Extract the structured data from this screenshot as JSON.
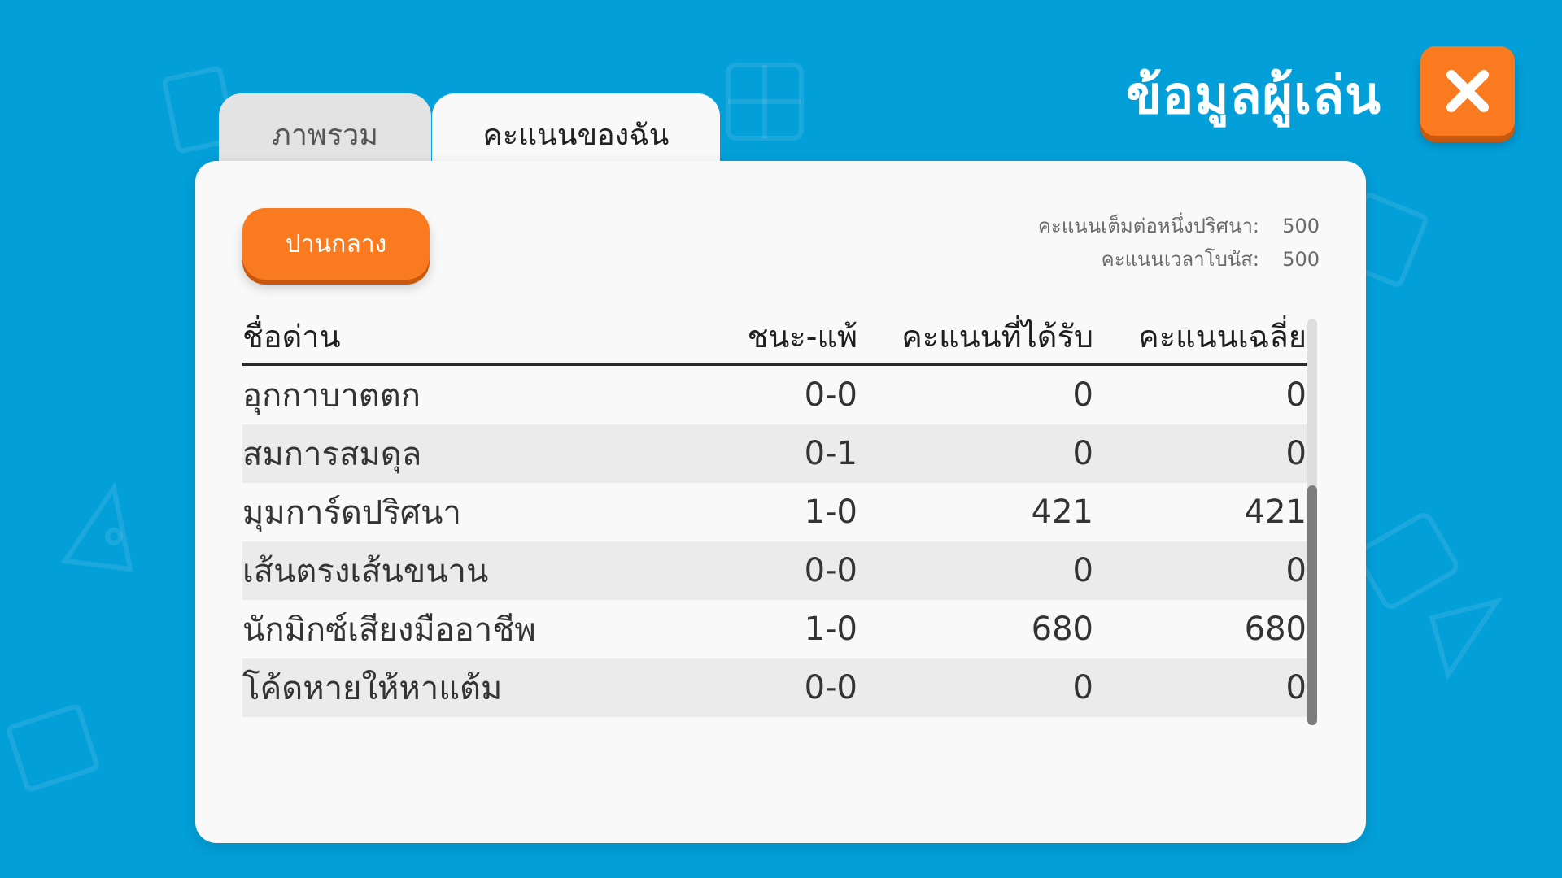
{
  "title": "ข้อมูลผู้เล่น",
  "tabs": {
    "overview": "ภาพรวม",
    "my_score": "คะแนนของฉัน"
  },
  "level_button": "ปานกลาง",
  "info": {
    "full_score_label": "คะแนนเต็มต่อหนึ่งปริศนา:",
    "full_score_value": "500",
    "bonus_label": "คะแนนเวลาโบนัส:",
    "bonus_value": "500"
  },
  "table": {
    "headers": {
      "name": "ชื่อด่าน",
      "win_loss": "ชนะ-แพ้",
      "score": "คะแนนที่ได้รับ",
      "average": "คะแนนเฉลี่ย"
    },
    "rows": [
      {
        "name": "อุกกาบาตตก",
        "win_loss": "0-0",
        "score": "0",
        "average": "0"
      },
      {
        "name": "สมการสมดุล",
        "win_loss": "0-1",
        "score": "0",
        "average": "0"
      },
      {
        "name": "มุมการ์ดปริศนา",
        "win_loss": "1-0",
        "score": "421",
        "average": "421"
      },
      {
        "name": "เส้นตรงเส้นขนาน",
        "win_loss": "0-0",
        "score": "0",
        "average": "0"
      },
      {
        "name": "นักมิกซ์เสียงมืออาชีพ",
        "win_loss": "1-0",
        "score": "680",
        "average": "680"
      },
      {
        "name": "โค้ดหายให้หาแต้ม",
        "win_loss": "0-0",
        "score": "0",
        "average": "0"
      }
    ]
  },
  "icons": {
    "close": "close-x-icon"
  },
  "colors": {
    "background": "#039fd9",
    "accent": "#f97a1f",
    "panel": "#f9f9f9"
  }
}
